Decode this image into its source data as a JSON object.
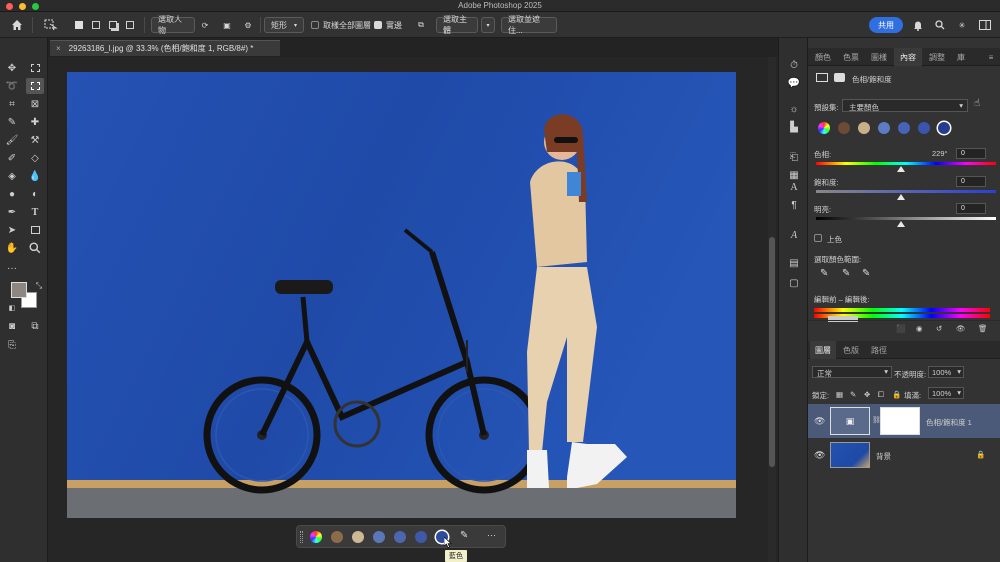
{
  "window": {
    "title": "Adobe Photoshop 2025"
  },
  "options_bar": {
    "select_subject_label": "選取人物",
    "shape_label": "矩形",
    "sample_all_layers_label": "取樣全部圖層",
    "hard_edge_label": "實邊",
    "select_subject_button": "選取主體",
    "select_and_mask_button": "選取並遮住...",
    "share_button": "共用"
  },
  "document": {
    "tab_title": "29263186_l.jpg @ 33.3% (色相/飽和度 1, RGB/8#) *",
    "close": "×"
  },
  "contextual_bar": {
    "tooltip": "藍色",
    "more": "···",
    "swatches": [
      "#8b6b4a",
      "#cdb994",
      "#5a78b8",
      "#4d66b0",
      "#3d59a8",
      "#2d4c9e"
    ]
  },
  "right_panel": {
    "top_tabs": [
      "顏色",
      "色票",
      "圖樣",
      "內容",
      "調整",
      "庫"
    ],
    "active_top_tab": "內容",
    "adjustment_title": "色相/飽和度",
    "preset_label": "預設集:",
    "preset_value": "主要顏色",
    "swatches": [
      "#6b4b34",
      "#c7b08a",
      "#5d7cc4",
      "#4763b6",
      "#3a56ac",
      "#243d8c"
    ],
    "hue_label": "色相:",
    "hue_value": "229°",
    "hue_box": "0",
    "saturation_label": "飽和度:",
    "saturation_box": "0",
    "lightness_label": "明亮:",
    "lightness_box": "0",
    "colorize_label": "上色",
    "color_range_label": "選取顏色範圍:",
    "before_after_label": "編輯前 – 編輯後:"
  },
  "layers_panel": {
    "tabs": [
      "圖層",
      "色版",
      "路徑"
    ],
    "active_tab": "圖層",
    "blend_mode": "正常",
    "opacity_label": "不透明度:",
    "opacity_value": "100%",
    "lock_label": "鎖定:",
    "fill_label": "填滿:",
    "fill_value": "100%",
    "layers": [
      {
        "name": "色相/飽和度 1",
        "selected": true
      },
      {
        "name": "背景",
        "selected": false
      }
    ]
  }
}
